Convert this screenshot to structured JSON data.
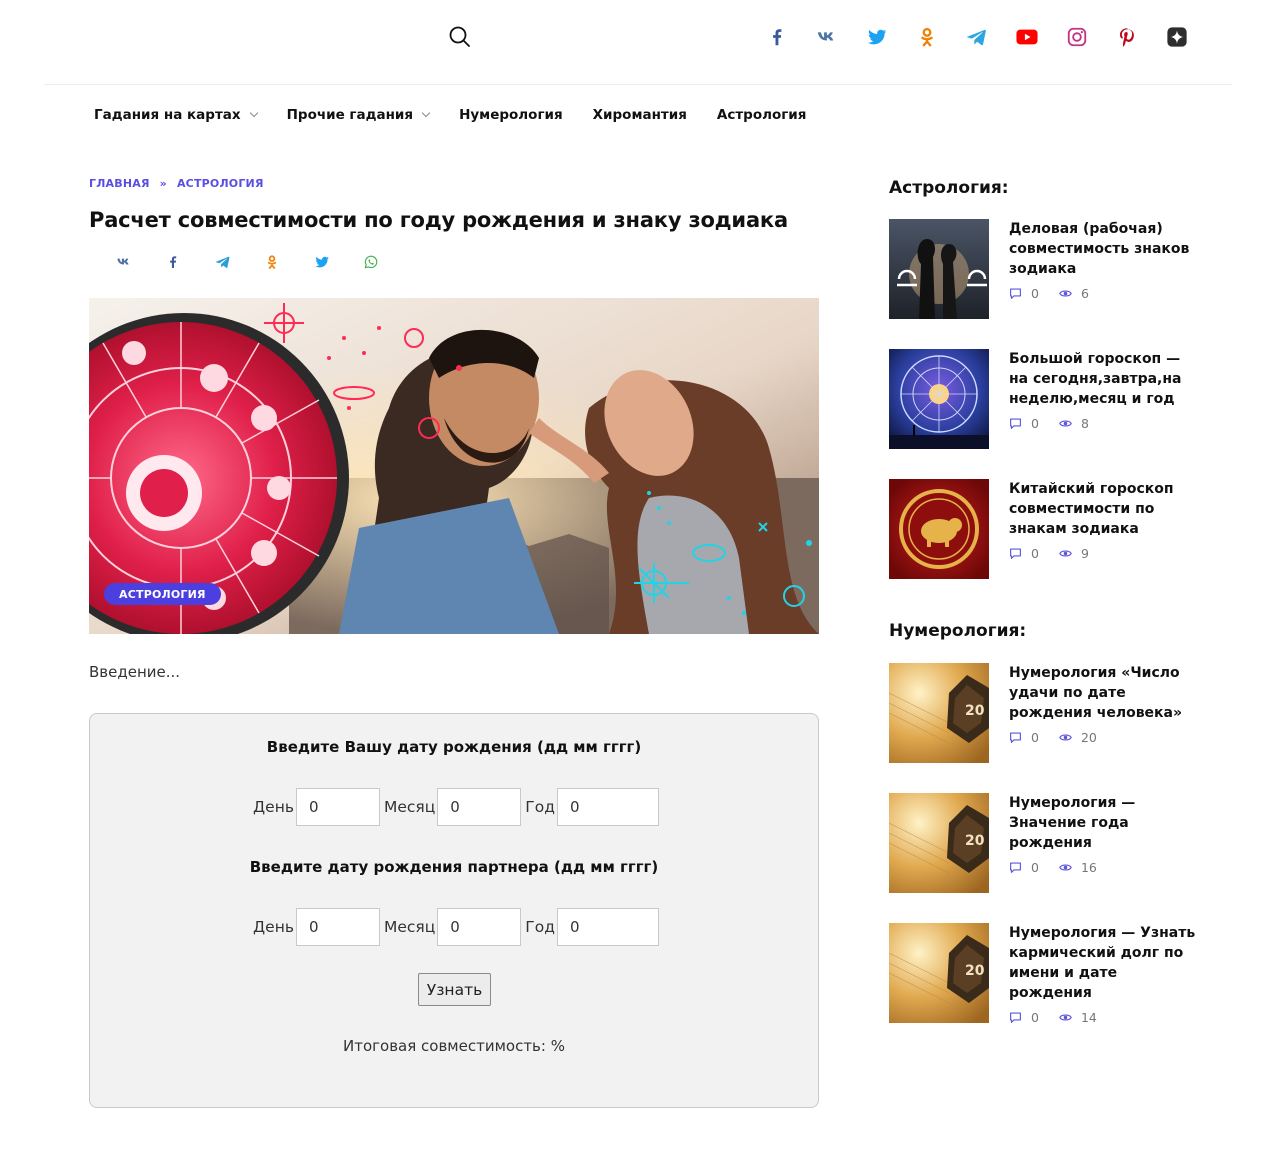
{
  "header": {
    "socials": [
      {
        "name": "facebook-icon",
        "color": "#3b5998"
      },
      {
        "name": "vk-icon",
        "color": "#4a76a8"
      },
      {
        "name": "twitter-icon",
        "color": "#1da1f2"
      },
      {
        "name": "odnoklassniki-icon",
        "color": "#ee8208"
      },
      {
        "name": "telegram-icon",
        "color": "#2ca5e0"
      },
      {
        "name": "youtube-icon",
        "color": "#ff0000"
      },
      {
        "name": "instagram-icon",
        "color": "#c13584"
      },
      {
        "name": "pinterest-icon",
        "color": "#bd081c"
      },
      {
        "name": "yandex-zen-icon",
        "color": "#2d2d2d"
      }
    ]
  },
  "nav": {
    "items": [
      {
        "label": "Гадания на картах",
        "dropdown": true
      },
      {
        "label": "Прочие гадания",
        "dropdown": true
      },
      {
        "label": "Нумерология",
        "dropdown": false
      },
      {
        "label": "Хиромантия",
        "dropdown": false
      },
      {
        "label": "Астрология",
        "dropdown": false
      }
    ]
  },
  "breadcrumb": {
    "home": "ГЛАВНАЯ",
    "separator": "»",
    "current": "АСТРОЛОГИЯ"
  },
  "post": {
    "title": "Расчет совместимости по году рождения и знаку зодиака",
    "category_badge": "АСТРОЛОГИЯ",
    "intro": "Введение..."
  },
  "share": [
    "vk-icon",
    "facebook-icon",
    "telegram-icon",
    "odnoklassniki-icon",
    "twitter-icon",
    "whatsapp-icon"
  ],
  "calculator": {
    "heading_you": "Введите Вашу дату рождения (дд мм гггг)",
    "heading_partner": "Введите дату рождения партнера (дд мм гггг)",
    "day_label": "День",
    "month_label": "Месяц",
    "year_label": "Год",
    "you": {
      "day": "0",
      "month": "0",
      "year": "0"
    },
    "partner": {
      "day": "0",
      "month": "0",
      "year": "0"
    },
    "button": "Узнать",
    "result": "Итоговая совместимость: %"
  },
  "sidebar": {
    "astro_heading": "Астрология:",
    "astro": [
      {
        "title": "Деловая (рабочая) совместимость знаков зодиака",
        "comments": "0",
        "views": "6"
      },
      {
        "title": "Большой гороскоп — на сегодня,завтра,на неделю,месяц и год",
        "comments": "0",
        "views": "8"
      },
      {
        "title": "Китайский гороскоп совместимости по знакам зодиака",
        "comments": "0",
        "views": "9"
      }
    ],
    "numero_heading": "Нумерология:",
    "numero": [
      {
        "title": "Нумерология «Число удачи по дате рождения человека»",
        "comments": "0",
        "views": "20"
      },
      {
        "title": "Нумерология — Значение года рождения",
        "comments": "0",
        "views": "16"
      },
      {
        "title": "Нумерология — Узнать кармический долг по имени и дате рождения",
        "comments": "0",
        "views": "14"
      }
    ]
  }
}
